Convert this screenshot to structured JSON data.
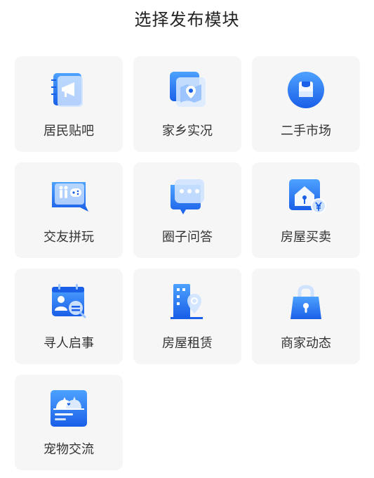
{
  "header": {
    "title": "选择发布模块"
  },
  "modules": [
    {
      "label": "居民贴吧",
      "icon": "megaphone-icon"
    },
    {
      "label": "家乡实况",
      "icon": "map-icon"
    },
    {
      "label": "二手市场",
      "icon": "shopping-bag-icon"
    },
    {
      "label": "交友拼玩",
      "icon": "people-gamepad-icon"
    },
    {
      "label": "圈子问答",
      "icon": "chat-bubble-icon"
    },
    {
      "label": "房屋买卖",
      "icon": "house-price-icon"
    },
    {
      "label": "寻人启事",
      "icon": "person-search-icon"
    },
    {
      "label": "房屋租赁",
      "icon": "building-location-icon"
    },
    {
      "label": "商家动态",
      "icon": "lock-bag-icon"
    },
    {
      "label": "宠物交流",
      "icon": "pet-icon"
    }
  ],
  "colors": {
    "accent": "#1e6ff5",
    "card_bg": "#f6f6f7"
  }
}
